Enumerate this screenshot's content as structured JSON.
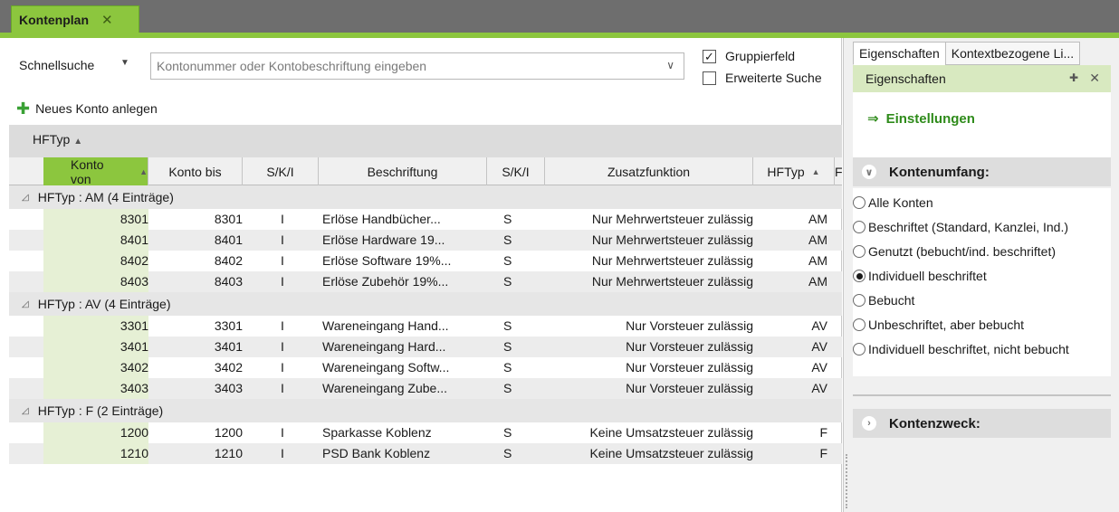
{
  "tab": {
    "title": "Kontenplan",
    "close": "✕"
  },
  "search": {
    "label": "Schnellsuche",
    "placeholder": "Kontonummer oder Kontobeschriftung eingeben",
    "gruppierfeld_label": "Gruppierfeld",
    "gruppierfeld_checked": true,
    "erweiterte_label": "Erweiterte Suche",
    "erweiterte_checked": false
  },
  "toolbar": {
    "new_account": "Neues Konto anlegen"
  },
  "groupby": {
    "chip": "HFTyp"
  },
  "columns": [
    "Konto von",
    "Konto bis",
    "S/K/I",
    "Beschriftung",
    "S/K/I",
    "Zusatzfunktion",
    "HFTyp",
    "F"
  ],
  "groups": [
    {
      "label": "HFTyp : AM  (4 Einträge)",
      "rows": [
        [
          "8301",
          "8301",
          "I",
          "Erlöse Handbücher...",
          "S",
          "Nur Mehrwertsteuer zulässig",
          "AM"
        ],
        [
          "8401",
          "8401",
          "I",
          "Erlöse Hardware 19...",
          "S",
          "Nur Mehrwertsteuer zulässig",
          "AM"
        ],
        [
          "8402",
          "8402",
          "I",
          "Erlöse Software 19%...",
          "S",
          "Nur Mehrwertsteuer zulässig",
          "AM"
        ],
        [
          "8403",
          "8403",
          "I",
          "Erlöse Zubehör 19%...",
          "S",
          "Nur Mehrwertsteuer zulässig",
          "AM"
        ]
      ]
    },
    {
      "label": "HFTyp : AV  (4 Einträge)",
      "rows": [
        [
          "3301",
          "3301",
          "I",
          "Wareneingang Hand...",
          "S",
          "Nur Vorsteuer zulässig",
          "AV"
        ],
        [
          "3401",
          "3401",
          "I",
          "Wareneingang Hard...",
          "S",
          "Nur Vorsteuer zulässig",
          "AV"
        ],
        [
          "3402",
          "3402",
          "I",
          "Wareneingang Softw...",
          "S",
          "Nur Vorsteuer zulässig",
          "AV"
        ],
        [
          "3403",
          "3403",
          "I",
          "Wareneingang Zube...",
          "S",
          "Nur Vorsteuer zulässig",
          "AV"
        ]
      ]
    },
    {
      "label": "HFTyp : F  (2 Einträge)",
      "rows": [
        [
          "1200",
          "1200",
          "I",
          "Sparkasse Koblenz",
          "S",
          "Keine Umsatzsteuer zulässig",
          "F"
        ],
        [
          "1210",
          "1210",
          "I",
          "PSD Bank Koblenz",
          "S",
          "Keine Umsatzsteuer zulässig",
          "F"
        ]
      ]
    }
  ],
  "right": {
    "tabs": [
      "Eigenschaften",
      "Kontextbezogene Li..."
    ],
    "panel_title": "Eigenschaften",
    "settings_link": "Einstellungen",
    "kontenumfang_title": "Kontenumfang:",
    "radio_options": [
      "Alle Konten",
      "Beschriftet (Standard, Kanzlei, Ind.)",
      "Genutzt (bebucht/ind. beschriftet)",
      "Individuell beschriftet",
      "Bebucht",
      "Unbeschriftet, aber bebucht",
      "Individuell beschriftet, nicht bebucht"
    ],
    "selected_index": 3,
    "kontenzweck_title": "Kontenzweck:"
  },
  "colors": {
    "accent": "#8cc63e",
    "link": "#2e8b1a",
    "titlebar": "#6e6e6e"
  }
}
